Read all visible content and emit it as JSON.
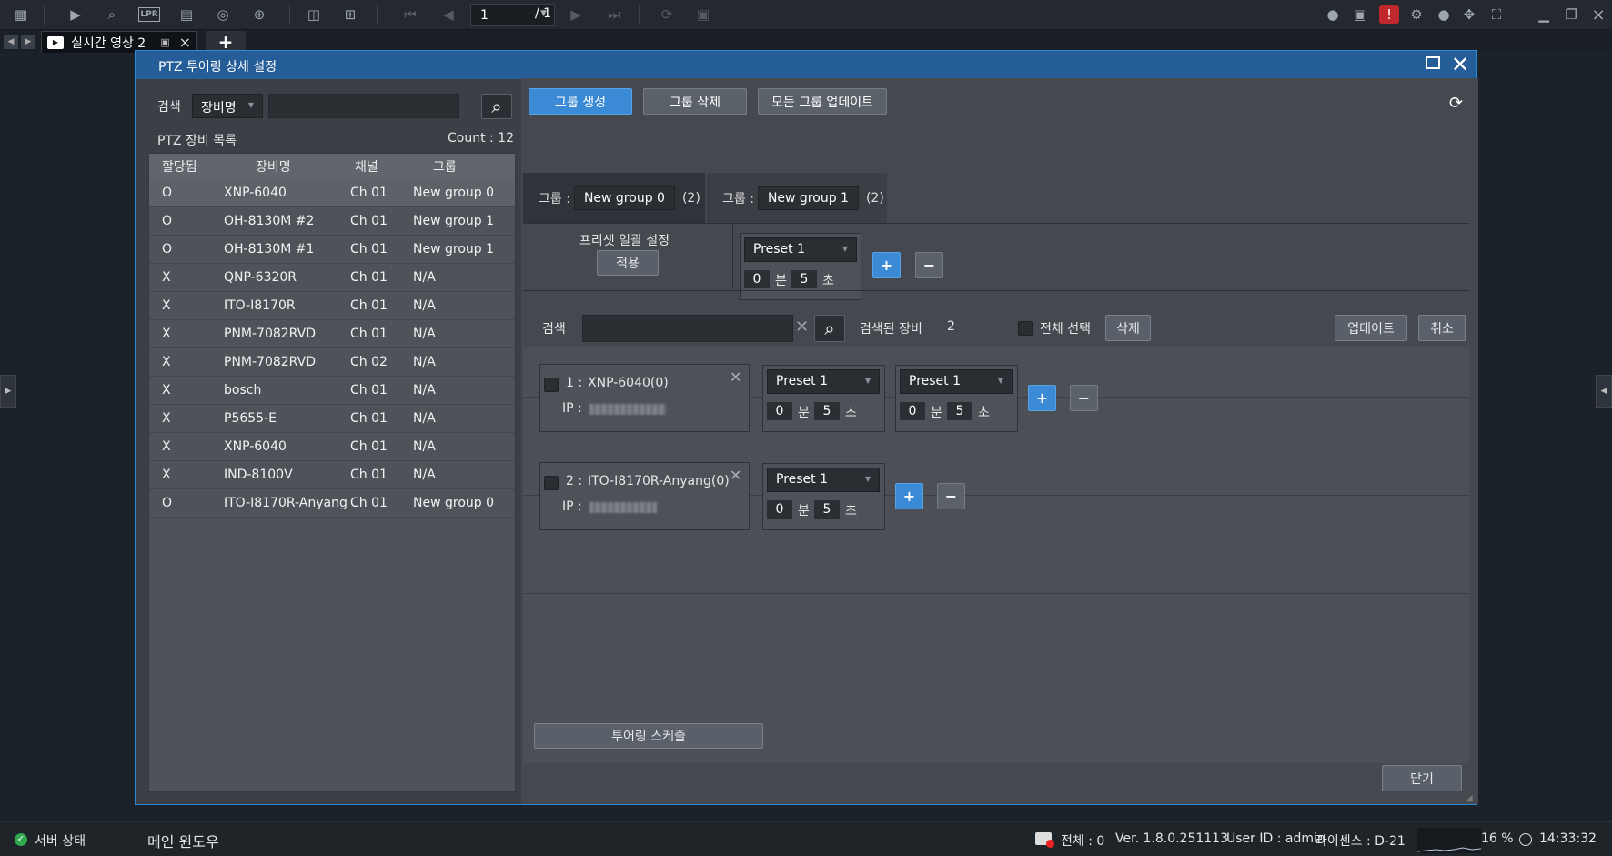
{
  "toolbar": {
    "page_current": "1",
    "page_total": "/ 1",
    "left_icons": [
      "apps-icon",
      "play-icon",
      "search-video-icon",
      "lpr-icon",
      "event-search-icon",
      "face-search-icon",
      "vehicle-search-icon"
    ],
    "lpr_label": "LPR"
  },
  "tabs": {
    "live_tab_label": "실시간 영상 2",
    "add_tab_label": "+"
  },
  "dialog": {
    "title": "PTZ 투어링 상세 설정",
    "left": {
      "search_label": "검색",
      "search_field_value": "장비명",
      "search_input_value": "",
      "list_title": "PTZ 장비 목록",
      "count_label": "Count : 12",
      "columns": [
        "할당됨",
        "장비명",
        "채널",
        "그룹"
      ],
      "rows": [
        {
          "assigned": "O",
          "name": "XNP-6040",
          "channel": "Ch 01",
          "group": "New group 0"
        },
        {
          "assigned": "O",
          "name": "OH-8130M #2",
          "channel": "Ch 01",
          "group": "New group 1"
        },
        {
          "assigned": "O",
          "name": "OH-8130M #1",
          "channel": "Ch 01",
          "group": "New group 1"
        },
        {
          "assigned": "X",
          "name": "QNP-6320R",
          "channel": "Ch 01",
          "group": "N/A"
        },
        {
          "assigned": "X",
          "name": "ITO-I8170R",
          "channel": "Ch 01",
          "group": "N/A"
        },
        {
          "assigned": "X",
          "name": "PNM-7082RVD",
          "channel": "Ch 01",
          "group": "N/A"
        },
        {
          "assigned": "X",
          "name": "PNM-7082RVD",
          "channel": "Ch 02",
          "group": "N/A"
        },
        {
          "assigned": "X",
          "name": "bosch",
          "channel": "Ch 01",
          "group": "N/A"
        },
        {
          "assigned": "X",
          "name": "P5655-E",
          "channel": "Ch 01",
          "group": "N/A"
        },
        {
          "assigned": "X",
          "name": "XNP-6040",
          "channel": "Ch 01",
          "group": "N/A"
        },
        {
          "assigned": "X",
          "name": "IND-8100V",
          "channel": "Ch 01",
          "group": "N/A"
        },
        {
          "assigned": "O",
          "name": "ITO-I8170R-Anyang",
          "channel": "Ch 01",
          "group": "New group 0"
        }
      ]
    },
    "right": {
      "btn_create_group": "그룹 생성",
      "btn_delete_group": "그룹 삭제",
      "btn_update_all": "모든 그룹 업데이트",
      "group_tabs": [
        {
          "label": "그룹 :",
          "name": "New group 0",
          "count": "(2)"
        },
        {
          "label": "그룹 :",
          "name": "New group 1",
          "count": "(2)"
        }
      ],
      "preset_batch_label": "프리셋 일괄 설정",
      "apply_button": "적용",
      "batch_preset": {
        "preset": "Preset 1",
        "min": "0",
        "min_unit": "분",
        "sec": "5",
        "sec_unit": "초"
      },
      "plus": "+",
      "minus": "−",
      "search_label": "검색",
      "search_value": "",
      "found_label": "검색된 장비",
      "found_count": "2",
      "select_all_label": "전체 선택",
      "delete_button": "삭제",
      "update_button": "업데이트",
      "cancel_button": "취소",
      "devices": [
        {
          "index": "1 :",
          "name": "XNP-6040(0)",
          "ip_label": "IP :",
          "presets": [
            {
              "preset": "Preset 1",
              "min": "0",
              "min_unit": "분",
              "sec": "5",
              "sec_unit": "초"
            },
            {
              "preset": "Preset 1",
              "min": "0",
              "min_unit": "분",
              "sec": "5",
              "sec_unit": "초"
            }
          ]
        },
        {
          "index": "2 :",
          "name": "ITO-I8170R-Anyang(0)",
          "ip_label": "IP :",
          "presets": [
            {
              "preset": "Preset 1",
              "min": "0",
              "min_unit": "분",
              "sec": "5",
              "sec_unit": "초"
            }
          ]
        }
      ],
      "touring_schedule_button": "투어링 스케줄",
      "close_button": "닫기"
    }
  },
  "statusbar": {
    "server_status": "서버 상태",
    "main_window": "메인 윈도우",
    "total": "전체 : 0",
    "version": "Ver. 1.8.0.251113",
    "user": "User ID : admin",
    "license": "라이센스 : D-21",
    "cpu": "16 %",
    "time": "14:33:32"
  }
}
